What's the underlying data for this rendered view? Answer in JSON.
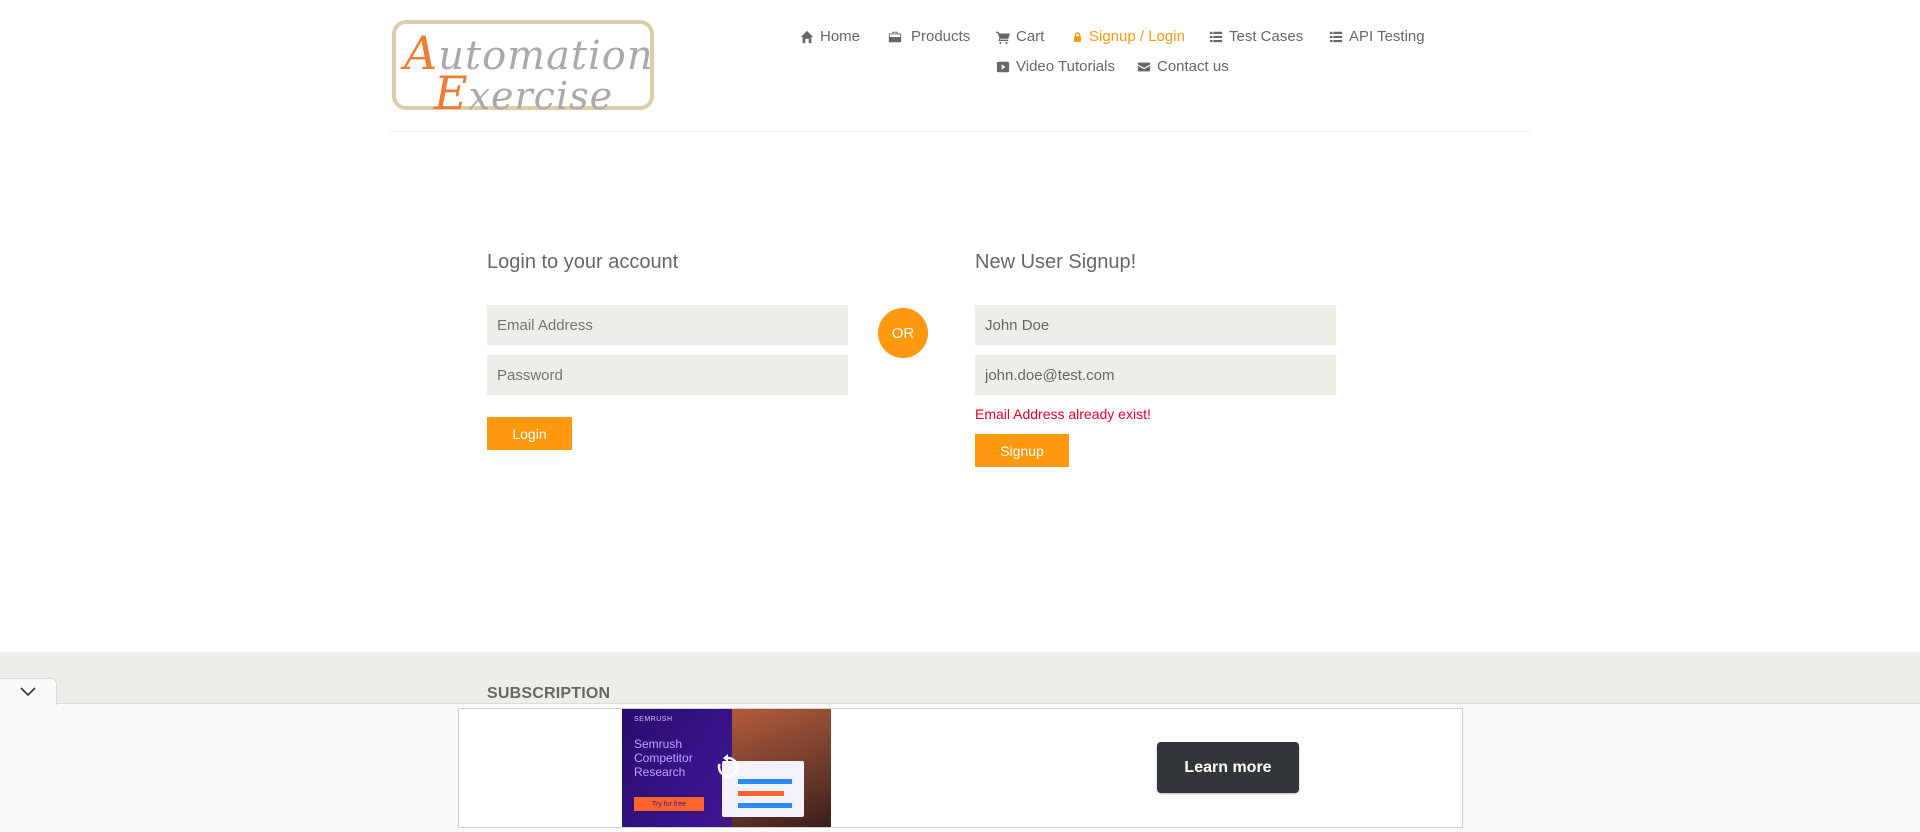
{
  "logo": {
    "line1_cap": "A",
    "line1_rest": "utomation",
    "line2_cap": "E",
    "line2_rest": "xercise"
  },
  "nav": {
    "home": "Home",
    "products": "Products",
    "cart": "Cart",
    "signup_login": "Signup / Login",
    "test_cases": "Test Cases",
    "api_testing": "API Testing",
    "video_tutorials": "Video Tutorials",
    "contact_us": "Contact us",
    "icons": [
      "home-icon",
      "briefcase-icon",
      "cart-icon",
      "lock-icon",
      "list-icon",
      "list-icon",
      "youtube-icon",
      "envelope-icon"
    ]
  },
  "login": {
    "title": "Login to your account",
    "email_placeholder": "Email Address",
    "password_placeholder": "Password",
    "button": "Login"
  },
  "or_label": "OR",
  "signup": {
    "title": "New User Signup!",
    "name_value": "John Doe",
    "email_value": "john.doe@test.com",
    "error": "Email Address already exist!",
    "button": "Signup"
  },
  "footer": {
    "subscription": "SUBSCRIPTION"
  },
  "ad": {
    "brand": "SEMRUSH",
    "headline": "Semrush Competitor Research",
    "cta": "Try for free",
    "button": "Learn more"
  },
  "colors": {
    "accent": "#fe980f",
    "error": "#e4002b",
    "field_bg": "#eeede7",
    "text": "#696763"
  }
}
